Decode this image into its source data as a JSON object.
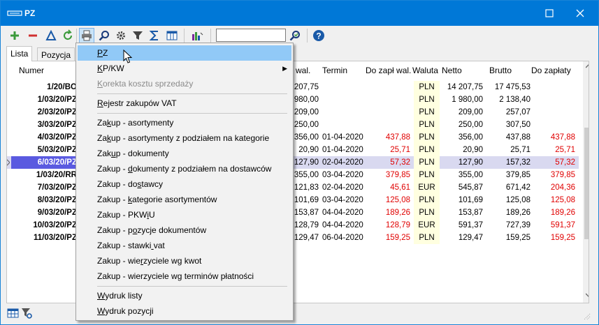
{
  "window": {
    "title": "PZ",
    "colors": {
      "titlebar": "#0078d7",
      "menu_highlight": "#91c9f7",
      "red_values": "#e00000",
      "selected_row": "#d9d9f0"
    }
  },
  "titlebar_icons": [
    "app-icon",
    "maximize-icon",
    "close-icon"
  ],
  "toolbar": {
    "icons": [
      "add-icon",
      "remove-icon",
      "triangle-icon",
      "refresh-icon",
      "print-icon",
      "search-icon",
      "settings-gear-icon",
      "filter-icon",
      "sum-icon",
      "columns-icon",
      "chart-icon",
      "search-go-icon",
      "help-icon"
    ],
    "search_value": ""
  },
  "tabs": [
    "Lista",
    "Pozycja"
  ],
  "grid": {
    "headers": [
      "Numer",
      "wal.",
      "Termin",
      "Do zapł wal.",
      "Waluta",
      "Netto",
      "Brutto",
      "Do zapłaty"
    ],
    "rows": [
      [
        "1/20/BO",
        "207,75",
        "",
        "",
        "PLN",
        "14 207,75",
        "17 475,53",
        ""
      ],
      [
        "1/03/20/PZ",
        "980,00",
        "",
        "",
        "PLN",
        "1 980,00",
        "2 138,40",
        ""
      ],
      [
        "2/03/20/PZ",
        "209,00",
        "",
        "",
        "PLN",
        "209,00",
        "257,07",
        ""
      ],
      [
        "3/03/20/PZ",
        "250,00",
        "",
        "",
        "PLN",
        "250,00",
        "307,50",
        ""
      ],
      [
        "4/03/20/PZ",
        "356,00",
        "01-04-2020",
        "437,88",
        "PLN",
        "356,00",
        "437,88",
        "437,88"
      ],
      [
        "5/03/20/PZ",
        "20,90",
        "01-04-2020",
        "25,71",
        "PLN",
        "20,90",
        "25,71",
        "25,71"
      ],
      [
        "6/03/20/PZ",
        "127,90",
        "02-04-2020",
        "57,32",
        "PLN",
        "127,90",
        "157,32",
        "57,32"
      ],
      [
        "1/03/20/RR",
        "355,00",
        "03-04-2020",
        "379,85",
        "PLN",
        "355,00",
        "379,85",
        "379,85"
      ],
      [
        "7/03/20/PZ",
        "121,83",
        "02-04-2020",
        "45,61",
        "EUR",
        "545,87",
        "671,42",
        "204,36"
      ],
      [
        "8/03/20/PZ",
        "101,69",
        "03-04-2020",
        "125,08",
        "PLN",
        "101,69",
        "125,08",
        "125,08"
      ],
      [
        "9/03/20/PZ",
        "153,87",
        "04-04-2020",
        "189,26",
        "PLN",
        "153,87",
        "189,26",
        "189,26"
      ],
      [
        "10/03/20/PZ",
        "128,79",
        "04-04-2020",
        "128,79",
        "EUR",
        "591,37",
        "727,39",
        "591,37"
      ],
      [
        "11/03/20/PZ",
        "129,47",
        "06-04-2020",
        "159,25",
        "PLN",
        "129,47",
        "159,25",
        "159,25"
      ]
    ],
    "selected_row": 6
  },
  "menu": {
    "items": [
      {
        "label": "PZ",
        "highlighted": true
      },
      {
        "label": "KP/KW",
        "submenu": true
      },
      {
        "label": "Korekta kosztu sprzedaży",
        "disabled": true
      },
      {
        "separator": true
      },
      {
        "label": "Rejestr zakupów VAT"
      },
      {
        "separator": true
      },
      {
        "label": "Zakup - asortymenty"
      },
      {
        "label": "Zakup - asortymenty z podziałem na kategorie"
      },
      {
        "label": "Zakup - dokumenty"
      },
      {
        "label": "Zakup - dokumenty z podziałem na dostawców"
      },
      {
        "label": "Zakup - dostawcy"
      },
      {
        "label": "Zakup - kategorie asortymentów"
      },
      {
        "label": "Zakup - PKWiU"
      },
      {
        "label": "Zakup - pozycje dokumentów"
      },
      {
        "label": "Zakup - stawki vat"
      },
      {
        "label": "Zakup - wierzyciele wg kwot"
      },
      {
        "label": "Zakup - wierzyciele wg terminów płatności"
      },
      {
        "separator": true
      },
      {
        "label": "Wydruk listy"
      },
      {
        "label": "Wydruk pozycji"
      }
    ]
  },
  "statusbar_icons": [
    "grid-view-icon",
    "filter-settings-icon",
    "resize-grip-icon"
  ]
}
